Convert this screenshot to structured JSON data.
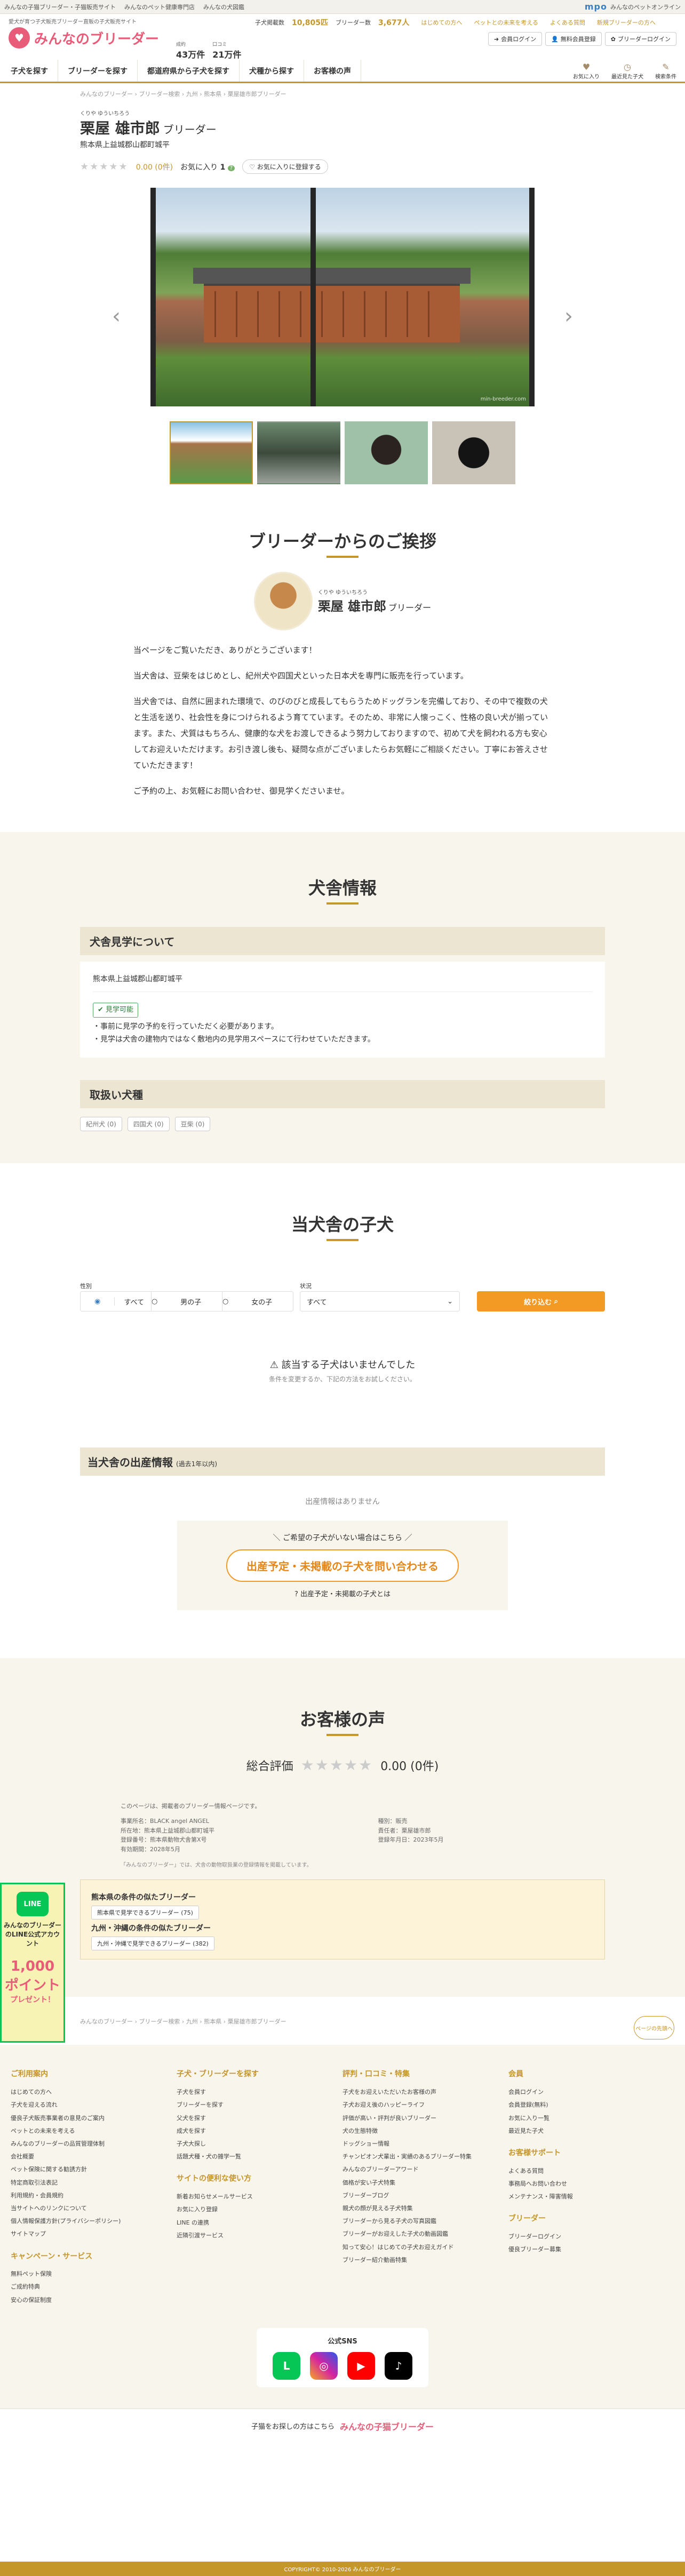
{
  "topbar": {
    "links": [
      "みんなの子猫ブリーダー・子猫販売サイト",
      "みんなのペット健康専門店",
      "みんなの犬図鑑"
    ],
    "brand": "mpo",
    "brand_sub": "みんなのペットオンライン"
  },
  "header": {
    "tagline": "愛犬が育つ子犬販売ブリーダー直販の子犬販売サイト",
    "logo": "みんなのブリーダー",
    "stats": [
      {
        "label": "成約",
        "value": "43万件"
      },
      {
        "label": "口コミ",
        "value": "21万件"
      }
    ],
    "stats_note": "※2024年4月時点 右脇注釈",
    "dogcount_label": "子犬掲載数",
    "dogcount": "10,805匹",
    "breeder_label": "ブリーダー数",
    "breeder": "3,677人",
    "util": [
      "はじめての方へ",
      "ペットとの未来を考える",
      "よくある質問",
      "新規ブリーダーの方へ"
    ],
    "btns": [
      "会員ログイン",
      "無料会員登録",
      "ブリーダーログイン"
    ]
  },
  "nav": {
    "items": [
      "子犬を探す",
      "ブリーダーを探す",
      "都道府県から子犬を探す",
      "犬種から探す",
      "お客様の声"
    ],
    "icons": [
      {
        "icon": "♥",
        "label": "お気に入り"
      },
      {
        "icon": "◷",
        "label": "最近見た子犬"
      },
      {
        "icon": "✎",
        "label": "検索条件"
      }
    ]
  },
  "breadcrumb": [
    "みんなのブリーダー",
    "ブリーダー検索",
    "九州",
    "熊本県",
    "栗屋雄市郎ブリーダー"
  ],
  "breeder": {
    "ruby": "くりや ゆういちろう",
    "name": "栗屋 雄市郎",
    "suffix": "ブリーダー",
    "location": "熊本県上益城郡山都町城平",
    "score": "0.00 (0件)",
    "fav_label": "お気に入り",
    "fav_count": "1",
    "fav_btn": "お気に入りに登録する",
    "watermark": "min-breeder.com"
  },
  "greeting": {
    "title": "ブリーダーからのご挨拶",
    "paragraphs": [
      "当ページをご覧いただき、ありがとうございます！",
      "当犬舎は、豆柴をはじめとし、紀州犬や四国犬といった日本犬を専門に販売を行っています。",
      "当犬舎では、自然に囲まれた環境で、のびのびと成長してもらうためドッグランを完備しており、その中で複数の犬と生活を送り、社会性を身につけられるよう育てています。そのため、非常に人懐っこく、性格の良い犬が揃っています。また、犬質はもちろん、健康的な犬をお渡しできるよう努力しておりますので、初めて犬を飼われる方も安心してお迎えいただけます。お引き渡し後も、疑問な点がございましたらお気軽にご相談ください。丁寧にお答えさせていただきます！",
      "ご予約の上、お気軽にお問い合わせ、御見学くださいませ。"
    ]
  },
  "kennel": {
    "title": "犬舎情報",
    "visit_title": "犬舎見学について",
    "address": "熊本県上益城郡山都町城平",
    "visit_ok": "見学可能",
    "notes": [
      "・事前に見学の予約を行っていただく必要があります。",
      "・見学は犬舎の建物内ではなく敷地内の見学用スペースにて行わせていただきます。"
    ],
    "breeds_title": "取扱い犬種",
    "breeds": [
      "紀州犬 (0)",
      "四国犬 (0)",
      "豆柴 (0)"
    ]
  },
  "puppies": {
    "title": "当犬舎の子犬",
    "sex_label": "性別",
    "sex_options": [
      "すべて",
      "男の子",
      "女の子"
    ],
    "status_label": "状況",
    "status_value": "すべて",
    "search_btn": "絞り込む",
    "empty": "該当する子犬はいませんでした",
    "empty_sub": "条件を変更するか、下記の方法をお試しください。"
  },
  "births": {
    "title": "当犬舎の出産情報",
    "sub": "(過去1年以内)",
    "none": "出産情報はありません",
    "lead": "ご希望の子犬がいない場合はこちら",
    "btn": "出産予定・未掲載の子犬を問い合わせる",
    "link": "出産予定・未掲載の子犬とは"
  },
  "reviews": {
    "title": "お客様の声",
    "label": "総合評価",
    "score": "0.00 (0件)"
  },
  "info": {
    "note": "このページは、掲載者のブリーダー情報ページです。",
    "rows": [
      "事業所名：BLACK angel ANGEL",
      "所在地：熊本県上益城郡山都町城平",
      "種別：販売",
      "責任者：栗屋雄市郎",
      "登録番号：熊本県動物犬舎第X号",
      "登録年月日：2023年5月",
      "有効期間：2028年5月"
    ],
    "disclaimer": "「みんなのブリーダー」では、犬舎の動物取扱業の登録情報を掲載しています。"
  },
  "near": {
    "h1": "熊本県の条件の似たブリーダー",
    "c1": "熊本県で見学できるブリーダー (75)",
    "h2": "九州・沖縄の条件の似たブリーダー",
    "c2": "九州・沖縄で見学できるブリーダー (382)"
  },
  "line_banner": {
    "l1": "LINE",
    "l2": "みんなのブリーダーのLINE公式アカウント",
    "l3": "1,000ポイント",
    "l4": "プレゼント！"
  },
  "pagetop": "ページの先頭へ",
  "footer": {
    "cols": [
      [
        {
          "h": "ご利用案内",
          "items": [
            "はじめての方へ",
            "子犬を迎える流れ",
            "優良子犬販売事業者の意見のご案内",
            "ペットとの未来を考える",
            "みんなのブリーダーの品質管理体制",
            "会社概要",
            "ペット保険に関する勧誘方針",
            "特定商取引法表記",
            "利用規約・会員規約",
            "当サイトへのリンクについて",
            "個人情報保護方針(プライバシーポリシー)",
            "サイトマップ"
          ]
        },
        {
          "h": "キャンペーン・サービス",
          "items": [
            "無料ペット保険",
            "ご成約特典",
            "安心の保証制度"
          ]
        }
      ],
      [
        {
          "h": "子犬・ブリーダーを探す",
          "items": [
            "子犬を探す",
            "ブリーダーを探す",
            "父犬を探す",
            "成犬を探す",
            "子犬大探し",
            "話題犬種・犬の雑学一覧"
          ]
        },
        {
          "h": "サイトの便利な使い方",
          "items": [
            "新着お知らせメールサービス",
            "お気に入り登録",
            "LINE の連携",
            "近隣引渡サービス"
          ]
        }
      ],
      [
        {
          "h": "評判・口コミ・特集",
          "items": [
            "子犬をお迎えいただいたお客様の声",
            "子犬お迎え後のハッピーライフ",
            "評価が高い・評判が良いブリーダー",
            "犬の生態特徴",
            "ドッグショー情報",
            "チャンピオン犬輩出・実績のあるブリーダー特集",
            "みんなのブリーダーアワード",
            "価格が安い子犬特集",
            "ブリーダーブログ",
            "親犬の顔が見える子犬特集",
            "ブリーダーから見る子犬の写真図鑑",
            "ブリーダーがお迎えした子犬の動画図鑑",
            "知って安心！はじめての子犬お迎えガイド",
            "ブリーダー紹介動画特集"
          ]
        }
      ],
      [
        {
          "h": "会員",
          "items": [
            "会員ログイン",
            "会員登録(無料)",
            "お気に入り一覧",
            "最近見た子犬"
          ]
        },
        {
          "h": "お客様サポート",
          "items": [
            "よくある質問",
            "事務局へお問い合わせ",
            "メンテナンス・障害情報"
          ]
        },
        {
          "h": "ブリーダー",
          "items": [
            "ブリーダーログイン",
            "優良ブリーダー募集"
          ]
        }
      ]
    ]
  },
  "sns": {
    "title": "公式SNS",
    "icons": [
      "LINE",
      "Instagram",
      "YouTube",
      "TikTok"
    ]
  },
  "catlink": {
    "text": "子猫をお探しの方はこちら",
    "logo": "みんなの子猫ブリーダー"
  },
  "copyright": "COPYRIGHT© 2010-2026 みんなのブリーダー"
}
